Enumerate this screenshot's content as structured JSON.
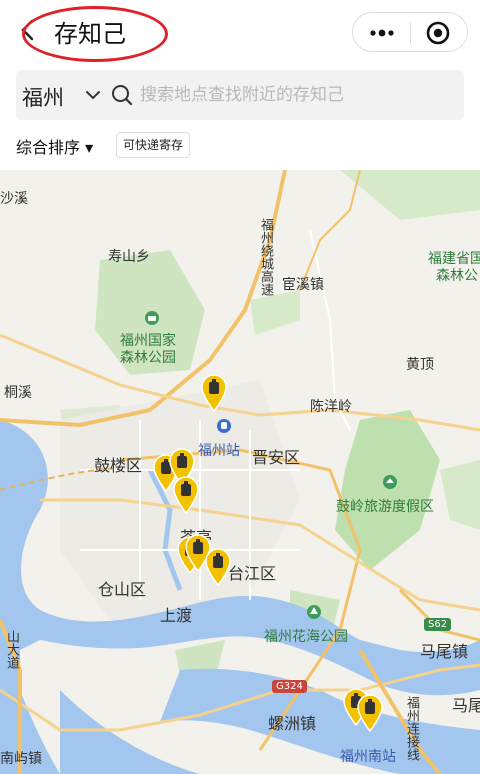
{
  "header": {
    "title": "存知己"
  },
  "search": {
    "city": "福州",
    "placeholder": "搜索地点查找附近的存知己"
  },
  "filters": {
    "sort_label": "综合排序 ▾",
    "tag_label": "可快递寄存"
  },
  "map": {
    "labels": {
      "shaxi": "沙溪",
      "shoushanxiang": "寿山乡",
      "fuzhou_forest_park": "福州国家",
      "fuzhou_forest_park_2": "森林公园",
      "huanxi": "宦溪镇",
      "fujian_forest_park": "福建省国",
      "fujian_forest_park_2": "森林公",
      "huangding": "黄顶",
      "tongxi": "桐溪",
      "chenyangling": "陈洋岭",
      "fuzhou_station": "福州站",
      "gulou": "鼓楼区",
      "jinan": "晋安区",
      "guling_resort": "鼓岭旅游度假区",
      "chating": "茶亭",
      "taijiang": "台江区",
      "cangshan": "仓山区",
      "shangdu": "上渡",
      "huahai_park": "福州花海公园",
      "maweizhen": "马尾镇",
      "mawei_edge": "马尾",
      "luozhouzhen": "螺洲镇",
      "fuzhou_south": "福州南站",
      "nanyuzhen": "南屿镇",
      "ring_expressway": "福州绕城高速",
      "dadao": "山大道",
      "connector": "福州连接线"
    },
    "shields": {
      "s62": "S62",
      "g324": "G324"
    },
    "marker_icon": "luggage-marker-icon"
  }
}
